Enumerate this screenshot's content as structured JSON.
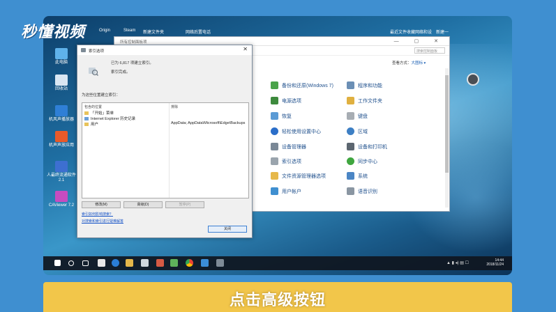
{
  "logo": "秒懂视频",
  "caption": "点击高级按钮",
  "top_icons": [
    "Origin",
    "Steam",
    "新建文件夹",
    "网络后置电话",
    "最近文件收藏",
    "网络和设",
    "新建一"
  ],
  "desktop_icons": [
    "此电脑",
    "回收站",
    "机风声播放器",
    "机声声放应用",
    "人最终流通软件2.1",
    "CAViewer 7.2"
  ],
  "control_panel": {
    "title": "所有控制面板项",
    "search_placeholder": "搜索控制面板",
    "view_by_label": "查看方式：",
    "view_by_value": "大图标 ▾",
    "items_left": [
      "备份和还原(Windows 7)",
      "电源选项",
      "恢复",
      "轻松使用设置中心",
      "设备管理器",
      "索引选项",
      "文件资源管理器选项",
      "用户帐户"
    ],
    "items_right": [
      "程序和功能",
      "工作文件夹",
      "键盘",
      "区域",
      "设备和打印机",
      "同步中心",
      "系统",
      "语音识别"
    ]
  },
  "dialog": {
    "title": "索引选项",
    "count_text": "已为 6,817 项建立索引。",
    "status_text": "索引完成。",
    "included_label": "为这些位置建立索引：",
    "col_locations": "包含的位置",
    "col_exclude": "排除",
    "locations": [
      "「开始」菜单",
      "Internet Explorer 历史记录",
      "用户"
    ],
    "exclude_value": "AppData; AppData\\Microsoft\\Edge\\Backups",
    "modify_label": "修改(M)",
    "advanced_label": "高级(D)",
    "pause_label": "暂停(P)",
    "link_search": "索引如何影响搜索？",
    "link_troubleshoot": "对搜索和索引进行疑难解答",
    "close_label": "关闭"
  },
  "taskbar": {
    "time": "14:44",
    "date": "2018/11/24"
  },
  "colors": {
    "accent": "#3f8fd0",
    "caption_bg": "#f2c64a",
    "link": "#1a56c8"
  }
}
